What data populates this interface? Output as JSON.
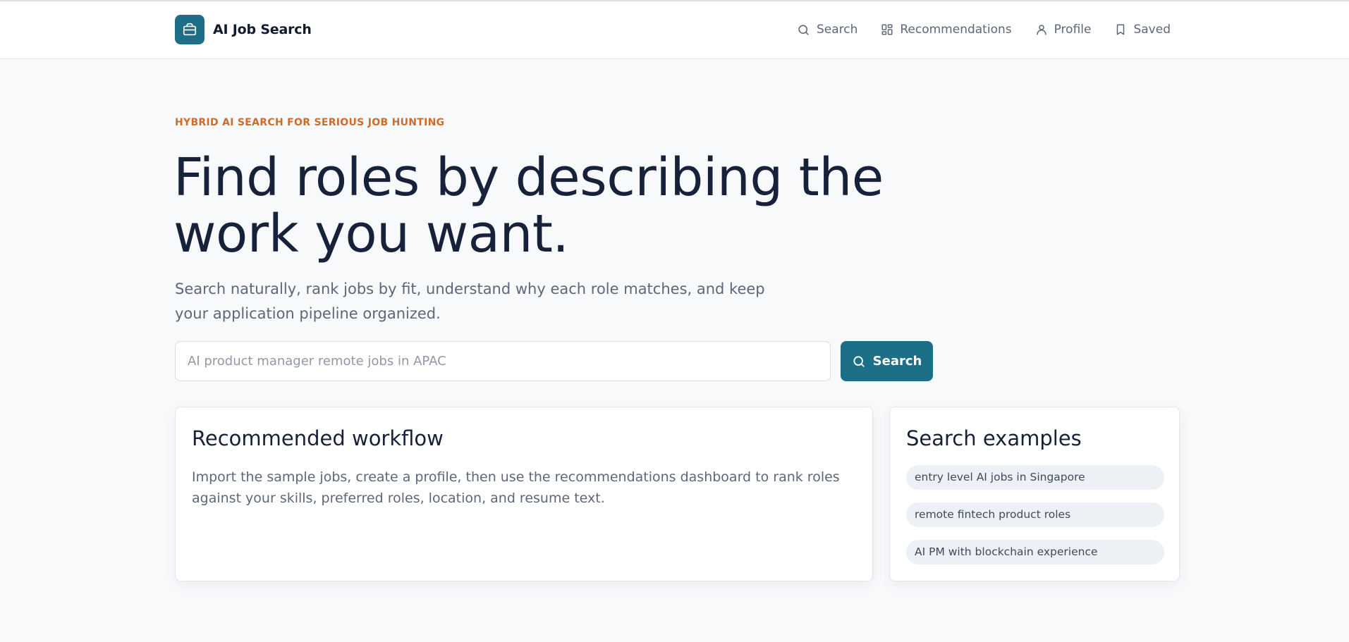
{
  "header": {
    "brand": "AI Job Search",
    "nav": [
      {
        "label": "Search",
        "icon": "search-icon"
      },
      {
        "label": "Recommendations",
        "icon": "grid-icon"
      },
      {
        "label": "Profile",
        "icon": "user-icon"
      },
      {
        "label": "Saved",
        "icon": "bookmark-icon"
      }
    ]
  },
  "hero": {
    "eyebrow": "HYBRID AI SEARCH FOR SERIOUS JOB HUNTING",
    "title": "Find roles by describing the work you want.",
    "lead": "Search naturally, rank jobs by fit, understand why each role matches, and keep your application pipeline organized."
  },
  "search": {
    "placeholder": "AI product manager remote jobs in APAC",
    "value": "",
    "button_label": "Search"
  },
  "workflow": {
    "title": "Recommended workflow",
    "body": "Import the sample jobs, create a profile, then use the recommendations dashboard to rank roles against your skills, preferred roles, location, and resume text."
  },
  "examples": {
    "title": "Search examples",
    "items": [
      "entry level AI jobs in Singapore",
      "remote fintech product roles",
      "AI PM with blockchain experience"
    ]
  },
  "colors": {
    "accent": "#1c6f86",
    "eyebrow": "#cf6b29",
    "background": "#f8f9fb"
  }
}
